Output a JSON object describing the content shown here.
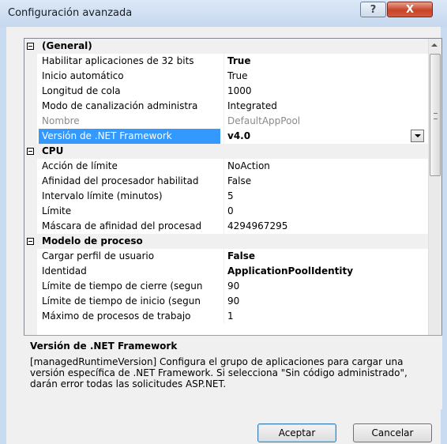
{
  "window": {
    "title": "Configuración avanzada",
    "help_glyph": "?",
    "close_glyph": "X"
  },
  "grid": {
    "rows": [
      {
        "kind": "category",
        "label": "(General)"
      },
      {
        "kind": "prop",
        "label": "Habilitar aplicaciones de 32 bits",
        "value": "True",
        "bold": true
      },
      {
        "kind": "prop",
        "label": "Inicio automático",
        "value": "True"
      },
      {
        "kind": "prop",
        "label": "Longitud de cola",
        "value": "1000"
      },
      {
        "kind": "prop",
        "label": "Modo de canalización administra",
        "value": "Integrated"
      },
      {
        "kind": "prop",
        "label": "Nombre",
        "value": "DefaultAppPool",
        "disabled": true
      },
      {
        "kind": "prop",
        "label": "Versión de .NET Framework",
        "value": "v4.0",
        "selected": true
      },
      {
        "kind": "category",
        "label": "CPU"
      },
      {
        "kind": "prop",
        "label": "Acción de límite",
        "value": "NoAction"
      },
      {
        "kind": "prop",
        "label": "Afinidad del procesador habilitad",
        "value": "False"
      },
      {
        "kind": "prop",
        "label": "Intervalo límite (minutos)",
        "value": "5"
      },
      {
        "kind": "prop",
        "label": "Límite",
        "value": "0"
      },
      {
        "kind": "prop",
        "label": "Máscara de afinidad del procesad",
        "value": "4294967295"
      },
      {
        "kind": "category",
        "label": "Modelo de proceso"
      },
      {
        "kind": "prop",
        "label": "Cargar perfil de usuario",
        "value": "False",
        "bold": true
      },
      {
        "kind": "prop",
        "label": "Identidad",
        "value": "ApplicationPoolIdentity",
        "bold": true
      },
      {
        "kind": "prop",
        "label": "Límite de tiempo de cierre (segun",
        "value": "90"
      },
      {
        "kind": "prop",
        "label": "Límite de tiempo de inicio (segun",
        "value": "90"
      },
      {
        "kind": "prop",
        "label": "Máximo de procesos de trabajo",
        "value": "1"
      }
    ]
  },
  "help": {
    "title": "Versión de .NET Framework",
    "description": "[managedRuntimeVersion] Configura el grupo de aplicaciones para cargar una versión específica de .NET Framework.  Si selecciona \"Sin código administrado\", darán error todas las solicitudes ASP.NET."
  },
  "buttons": {
    "ok": "Aceptar",
    "cancel": "Cancelar"
  }
}
